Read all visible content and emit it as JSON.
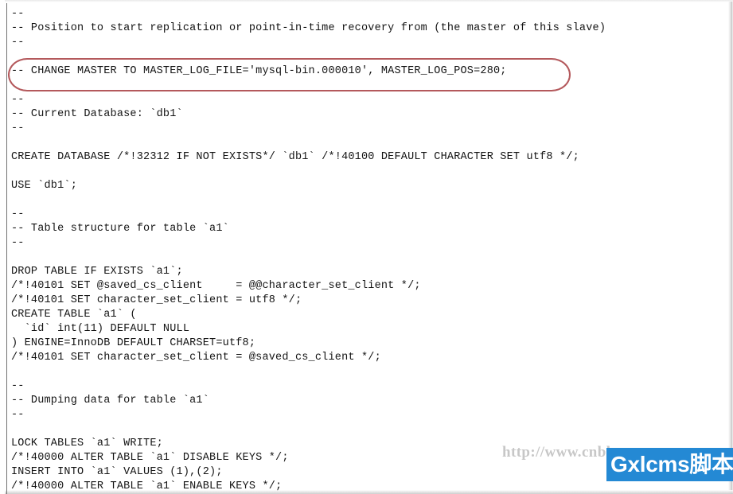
{
  "document": {
    "kind": "mysqldump-sql-output",
    "language": "sql"
  },
  "code": {
    "lines": [
      "--",
      "-- Position to start replication or point-in-time recovery from (the master of this slave)",
      "--",
      "",
      "-- CHANGE MASTER TO MASTER_LOG_FILE='mysql-bin.000010', MASTER_LOG_POS=280;",
      "",
      "--",
      "-- Current Database: `db1`",
      "--",
      "",
      "CREATE DATABASE /*!32312 IF NOT EXISTS*/ `db1` /*!40100 DEFAULT CHARACTER SET utf8 */;",
      "",
      "USE `db1`;",
      "",
      "--",
      "-- Table structure for table `a1`",
      "--",
      "",
      "DROP TABLE IF EXISTS `a1`;",
      "/*!40101 SET @saved_cs_client     = @@character_set_client */;",
      "/*!40101 SET character_set_client = utf8 */;",
      "CREATE TABLE `a1` (",
      "  `id` int(11) DEFAULT NULL",
      ") ENGINE=InnoDB DEFAULT CHARSET=utf8;",
      "/*!40101 SET character_set_client = @saved_cs_client */;",
      "",
      "--",
      "-- Dumping data for table `a1`",
      "--",
      "",
      "LOCK TABLES `a1` WRITE;",
      "/*!40000 ALTER TABLE `a1` DISABLE KEYS */;",
      "INSERT INTO `a1` VALUES (1),(2);",
      "/*!40000 ALTER TABLE `a1` ENABLE KEYS */;"
    ]
  },
  "annotation": {
    "type": "oval-highlight",
    "color": "#b4595c",
    "target_line": "-- CHANGE MASTER TO MASTER_LOG_FILE='mysql-bin.000010', MASTER_LOG_POS=280;"
  },
  "watermark": {
    "url_text": "http://www.cnbl",
    "badge_text": "Gxlcms脚本",
    "badge_color": "#2489d4",
    "url_color": "#9a9a9a"
  }
}
